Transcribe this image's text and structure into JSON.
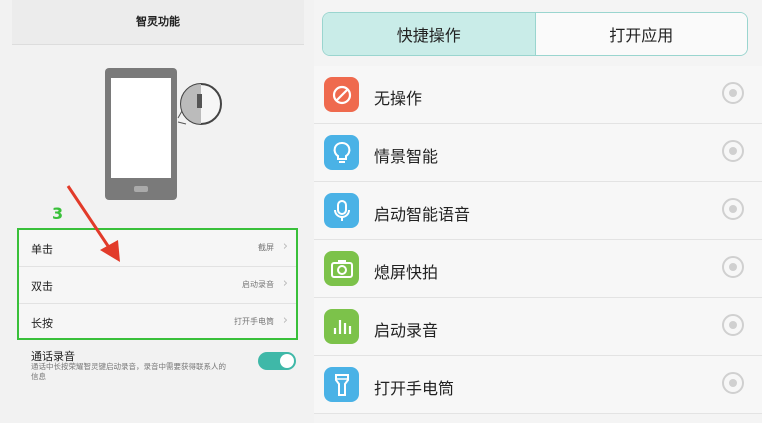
{
  "left": {
    "title": "智灵功能",
    "step_number": "3",
    "actions": [
      {
        "label": "单击",
        "value": "截屏"
      },
      {
        "label": "双击",
        "value": "启动录音"
      },
      {
        "label": "长按",
        "value": "打开手电筒"
      }
    ],
    "call_record": {
      "title": "通话录音",
      "description": "通话中长按荣耀智灵键启动录音，录音中需要获得联系人的信息",
      "enabled": true
    }
  },
  "right": {
    "tabs": [
      {
        "label": "快捷操作",
        "active": true
      },
      {
        "label": "打开应用",
        "active": false
      }
    ],
    "options": [
      {
        "label": "无操作",
        "icon": "no-action-icon",
        "color": "#ef6a4e"
      },
      {
        "label": "情景智能",
        "icon": "lightbulb-icon",
        "color": "#4ab2e6"
      },
      {
        "label": "启动智能语音",
        "icon": "microphone-icon",
        "color": "#4ab2e6"
      },
      {
        "label": "熄屏快拍",
        "icon": "camera-icon",
        "color": "#7cc24a"
      },
      {
        "label": "启动录音",
        "icon": "recorder-bars-icon",
        "color": "#7cc24a"
      },
      {
        "label": "打开手电筒",
        "icon": "flashlight-icon",
        "color": "#4ab2e6"
      }
    ]
  },
  "colors": {
    "highlight_box": "#39c03a",
    "arrow": "#e23b2a",
    "active_tab": "#c9ece8",
    "toggle_on": "#3fb8a8"
  }
}
